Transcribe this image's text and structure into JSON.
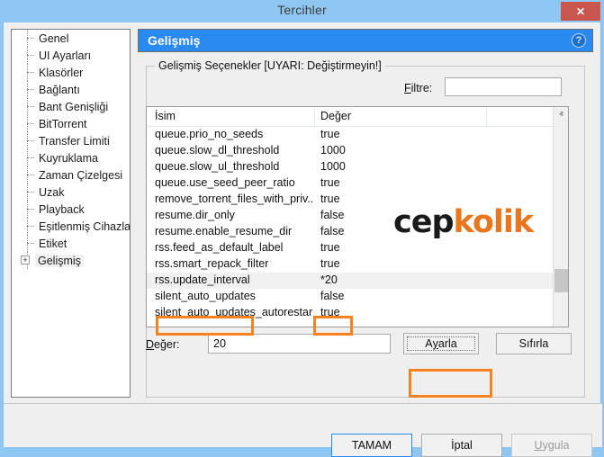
{
  "window": {
    "title": "Tercihler",
    "close_label": "✕"
  },
  "sidebar": {
    "items": [
      {
        "label": "Genel",
        "expandable": false,
        "selected": false
      },
      {
        "label": "UI Ayarları",
        "expandable": false,
        "selected": false
      },
      {
        "label": "Klasörler",
        "expandable": false,
        "selected": false
      },
      {
        "label": "Bağlantı",
        "expandable": false,
        "selected": false
      },
      {
        "label": "Bant Genişliği",
        "expandable": false,
        "selected": false
      },
      {
        "label": "BitTorrent",
        "expandable": false,
        "selected": false
      },
      {
        "label": "Transfer Limiti",
        "expandable": false,
        "selected": false
      },
      {
        "label": "Kuyruklama",
        "expandable": false,
        "selected": false
      },
      {
        "label": "Zaman Çizelgesi",
        "expandable": false,
        "selected": false
      },
      {
        "label": "Uzak",
        "expandable": false,
        "selected": false
      },
      {
        "label": "Playback",
        "expandable": false,
        "selected": false
      },
      {
        "label": "Eşitlenmiş Cihazlar",
        "expandable": false,
        "selected": false
      },
      {
        "label": "Etiket",
        "expandable": false,
        "selected": false
      },
      {
        "label": "Gelişmiş",
        "expandable": true,
        "expander": "+",
        "selected": true
      }
    ]
  },
  "panel": {
    "header_title": "Gelişmiş",
    "help_icon": "?",
    "groupbox_legend": "Gelişmiş Seçenekler [UYARI: Değiştirmeyin!]",
    "filter": {
      "label_prefix": "F",
      "label_rest": "iltre:",
      "value": "",
      "placeholder": ""
    },
    "table": {
      "columns": [
        "İsim",
        "Değer"
      ],
      "rows": [
        {
          "name": "queue.prio_no_seeds",
          "value": "true",
          "selected": false
        },
        {
          "name": "queue.slow_dl_threshold",
          "value": "1000",
          "selected": false
        },
        {
          "name": "queue.slow_ul_threshold",
          "value": "1000",
          "selected": false
        },
        {
          "name": "queue.use_seed_peer_ratio",
          "value": "true",
          "selected": false
        },
        {
          "name": "remove_torrent_files_with_priv...",
          "value": "true",
          "selected": false
        },
        {
          "name": "resume.dir_only",
          "value": "false",
          "selected": false
        },
        {
          "name": "resume.enable_resume_dir",
          "value": "false",
          "selected": false
        },
        {
          "name": "rss.feed_as_default_label",
          "value": "true",
          "selected": false
        },
        {
          "name": "rss.smart_repack_filter",
          "value": "true",
          "selected": false
        },
        {
          "name": "rss.update_interval",
          "value": "*20",
          "selected": true
        },
        {
          "name": "silent_auto_updates",
          "value": "false",
          "selected": false
        },
        {
          "name": "silent_auto_updates_autorestart",
          "value": "true",
          "selected": false
        }
      ],
      "scroll_up_icon": "ⱏ",
      "scroll_down_icon": "ⱟ"
    },
    "value_field": {
      "label_prefix": "D",
      "label_rest": "eğer:",
      "value": "20"
    },
    "set_button": {
      "prefix": "A",
      "underline": "y",
      "rest": "arla"
    },
    "reset_button": {
      "label": "Sıfırla"
    }
  },
  "footer": {
    "ok_label": "TAMAM",
    "cancel_label": "İptal",
    "apply_prefix": "U",
    "apply_rest": "ygula"
  },
  "watermark": {
    "dark": "cep",
    "orange": "kolik"
  },
  "colors": {
    "title_bar": "#8fc7f2",
    "close_button": "#c9564f",
    "panel_header": "#2b8aef",
    "annotation": "#f58220",
    "watermark_orange": "#e8761f",
    "background": "#efefef"
  }
}
